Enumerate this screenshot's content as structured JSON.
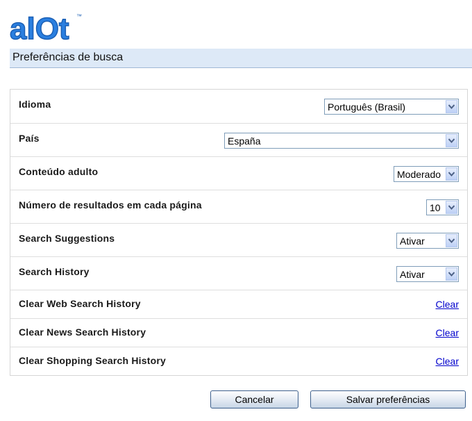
{
  "brand": {
    "logo_text": "alOt",
    "trademark": "™",
    "logo_color": "#2a7fe0"
  },
  "header": {
    "title": "Preferências de busca"
  },
  "preferences": [
    {
      "label": "Idioma",
      "value": "Português (Brasil)"
    },
    {
      "label": "País",
      "value": "España"
    },
    {
      "label": "Conteúdo adulto",
      "value": "Moderado"
    },
    {
      "label": "Número de resultados em cada página",
      "value": "10"
    },
    {
      "label": "Search Suggestions",
      "value": "Ativar"
    },
    {
      "label": "Search History",
      "value": "Ativar"
    }
  ],
  "clear_rows": [
    {
      "label": "Clear Web Search History",
      "link": "Clear"
    },
    {
      "label": "Clear News Search History",
      "link": "Clear"
    },
    {
      "label": "Clear Shopping Search History",
      "link": "Clear"
    }
  ],
  "buttons": {
    "cancel": "Cancelar",
    "save": "Salvar preferências"
  },
  "icons": {
    "dropdown": "chevron-down-icon"
  }
}
